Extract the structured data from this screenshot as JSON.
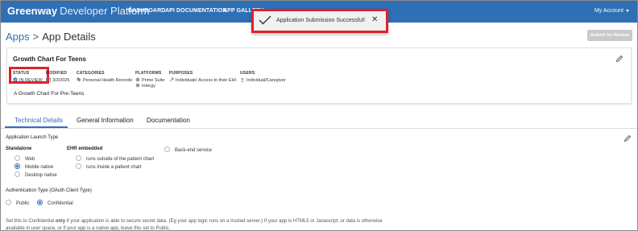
{
  "nav": {
    "brand_bold": "Greenway",
    "brand_rest": "Developer Platform",
    "links": [
      "DASHBOARD",
      "API DOCUMENTATION",
      "APP GALLERY"
    ],
    "account": "My Account"
  },
  "toast": {
    "message": "Application Submission Successful!"
  },
  "header": {
    "crumb_link": "Apps",
    "crumb_sep": ">",
    "crumb_current": "App Details",
    "submit_label": "Submit for Review"
  },
  "app": {
    "name": "Growth Chart For Teens",
    "status_label": "STATUS",
    "status_value": "IN REVIEW",
    "modified_label": "MODIFIED",
    "modified_value": "3/3/2025",
    "categories_label": "CATEGORIES",
    "categories_value": "Personal Health Records",
    "platforms_label": "PLATFORMS",
    "platforms": [
      "Prime Suite",
      "Intergy"
    ],
    "purposes_label": "PURPOSES",
    "purposes_value": "Individuals' Access to their EHI",
    "users_label": "USERS",
    "users_value": "Individual/Caregiver",
    "description": "A Growth Chart For Pre-Teens"
  },
  "tabs": [
    "Technical Details",
    "General Information",
    "Documentation"
  ],
  "form": {
    "launch_title": "Application Launch Type",
    "standalone_title": "Standalone",
    "standalone_options": [
      "Web",
      "Mobile native",
      "Desktop native"
    ],
    "ehr_title": "EHR embedded",
    "ehr_options": [
      "runs outside of the patient chart",
      "runs inside a patient chart"
    ],
    "backend_option": "Back-end service",
    "auth_title": "Authentication Type (OAuth Client Type)",
    "auth_options": [
      "Public",
      "Confidential"
    ],
    "note_pre": "Set this to Confidential ",
    "note_bold": "only",
    "note_post": " if your application is able to secure secret data. (Eg your app logic runs on a trusted server.) If your app is HTML5 or Javascript, or data is otherwise available in user space, or if your app is a native app, leave this set to Public."
  },
  "colors": {
    "nav": "#2f6fb5",
    "accent": "#2f6fb5",
    "highlight": "#e0202a",
    "disabled": "#c9c9c9"
  }
}
